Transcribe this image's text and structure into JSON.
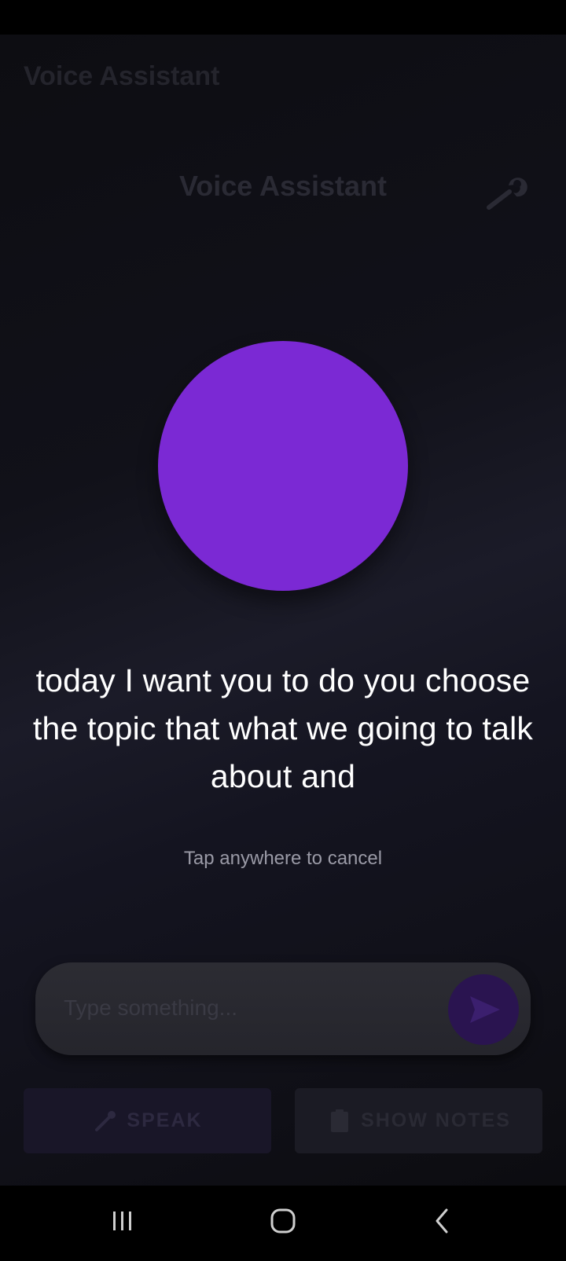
{
  "app": {
    "title": "Voice Assistant"
  },
  "header": {
    "title": "Voice Assistant",
    "settings_icon": "wrench-icon"
  },
  "listening": {
    "transcript": "today I want you to do you choose the topic that what we going to talk about and",
    "hint": "Tap anywhere to cancel",
    "orb_color": "#7b29d4"
  },
  "composer": {
    "placeholder": "Type something...",
    "value": "",
    "send_icon": "send-icon"
  },
  "actions": {
    "speak_label": "SPEAK",
    "speak_icon": "microphone-icon",
    "notes_label": "SHOW NOTES",
    "notes_icon": "clipboard-icon"
  },
  "navigation": {
    "recents_icon": "recents-icon",
    "home_icon": "home-icon",
    "back_icon": "back-icon"
  },
  "colors": {
    "accent": "#7b29d4",
    "background": "#111119",
    "text": "#ffffff"
  }
}
